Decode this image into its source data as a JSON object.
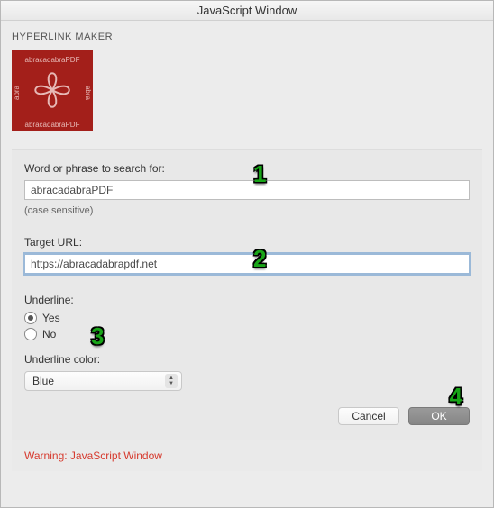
{
  "window": {
    "title": "JavaScript Window"
  },
  "header": {
    "app_name": "HYPERLINK MAKER"
  },
  "search": {
    "label": "Word or phrase to search for:",
    "value": "abracadabraPDF",
    "hint": "(case sensitive)"
  },
  "target": {
    "label": "Target URL:",
    "value": "https://abracadabrapdf.net"
  },
  "underline": {
    "label": "Underline:",
    "yes": "Yes",
    "no": "No",
    "selected": "yes",
    "color_label": "Underline color:",
    "color_value": "Blue"
  },
  "buttons": {
    "cancel": "Cancel",
    "ok": "OK"
  },
  "footer": {
    "warning": "Warning: JavaScript Window"
  },
  "callouts": {
    "c1": "1",
    "c2": "2",
    "c3": "3",
    "c4": "4"
  }
}
